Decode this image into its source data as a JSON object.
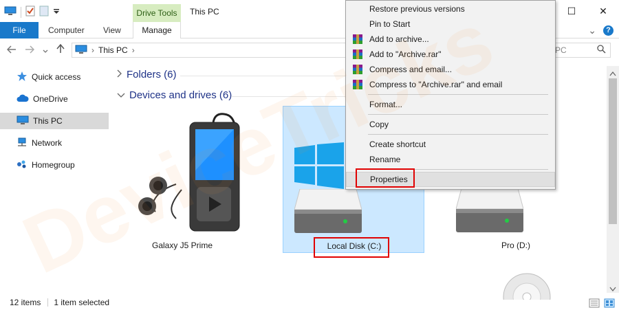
{
  "window": {
    "contextual_group": "Drive Tools",
    "title": "This PC",
    "min_glyph": "—",
    "max_glyph": "☐",
    "close_glyph": "✕"
  },
  "ribbon": {
    "tabs": {
      "file": "File",
      "computer": "Computer",
      "view": "View",
      "manage": "Manage"
    },
    "collapse_glyph": "⌄",
    "help_glyph": "?"
  },
  "address": {
    "path": "This PC",
    "separator": "›",
    "search_placeholder": "PC"
  },
  "nav": {
    "items": [
      {
        "label": "Quick access"
      },
      {
        "label": "OneDrive"
      },
      {
        "label": "This PC"
      },
      {
        "label": "Network"
      },
      {
        "label": "Homegroup"
      }
    ]
  },
  "sections": {
    "folders": "Folders (6)",
    "devices": "Devices and drives (6)"
  },
  "tiles": [
    {
      "label": "Galaxy J5 Prime"
    },
    {
      "label": "Local Disk (C:)"
    },
    {
      "label": "Pro (D:)"
    }
  ],
  "status": {
    "count": "12 items",
    "selection": "1 item selected"
  },
  "context_menu": {
    "items": [
      {
        "label": "Restore previous versions"
      },
      {
        "label": "Pin to Start"
      },
      {
        "label": "Add to archive..."
      },
      {
        "label": "Add to \"Archive.rar\""
      },
      {
        "label": "Compress and email..."
      },
      {
        "label": "Compress to \"Archive.rar\" and email"
      },
      {
        "label": "Format..."
      },
      {
        "label": "Copy"
      },
      {
        "label": "Create shortcut"
      },
      {
        "label": "Rename"
      },
      {
        "label": "Properties"
      }
    ]
  },
  "watermark": {
    "text": "DeviceTricks"
  },
  "colors": {
    "accent": "#1979ca",
    "highlight_box": "#e00000",
    "selection": "#cce8ff",
    "contextual_tab": "#d7ecc0",
    "section_heading": "#1e3287"
  }
}
